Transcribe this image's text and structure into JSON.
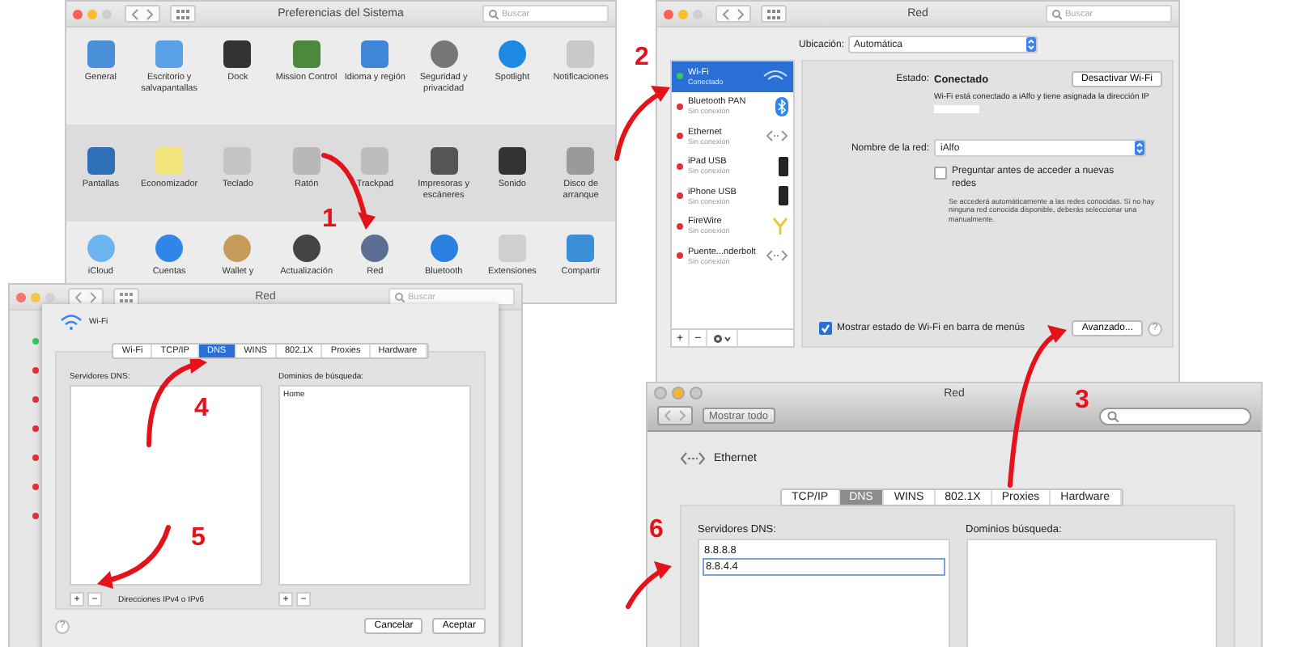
{
  "system_preferences": {
    "title": "Preferencias del Sistema",
    "search": {
      "placeholder": "Buscar"
    },
    "rows": [
      {
        "items": [
          "General",
          "Escritorio y salvapantallas",
          "Dock",
          "Mission Control",
          "Idioma y región",
          "Seguridad y privacidad",
          "Spotlight",
          "Notificaciones"
        ]
      },
      {
        "items": [
          "Pantallas",
          "Economizador",
          "Teclado",
          "Ratón",
          "Trackpad",
          "Impresoras y escáneres",
          "Sonido",
          "Disco de arranque"
        ]
      },
      {
        "items": [
          "iCloud",
          "Cuentas",
          "Wallet y",
          "Actualización",
          "Red",
          "Bluetooth",
          "Extensiones",
          "Compartir"
        ]
      }
    ]
  },
  "network_window": {
    "title": "Red",
    "search": {
      "placeholder": "Buscar"
    },
    "location_label": "Ubicación:",
    "location_value": "Automática",
    "services": [
      {
        "name": "Wi-Fi",
        "status": "Conectado",
        "selected": true,
        "color": "#34c759"
      },
      {
        "name": "Bluetooth PAN",
        "status": "Sin conexión",
        "selected": false,
        "color": "#e0303a"
      },
      {
        "name": "Ethernet",
        "status": "Sin conexión",
        "selected": false,
        "color": "#e0303a"
      },
      {
        "name": "iPad USB",
        "status": "Sin conexión",
        "selected": false,
        "color": "#e0303a"
      },
      {
        "name": "iPhone USB",
        "status": "Sin conexión",
        "selected": false,
        "color": "#e0303a"
      },
      {
        "name": "FireWire",
        "status": "Sin conexión",
        "selected": false,
        "color": "#e0303a"
      },
      {
        "name": "Puente...nderbolt",
        "status": "Sin conexión",
        "selected": false,
        "color": "#e0303a"
      }
    ],
    "sidebar_buttons": [
      "+",
      "−"
    ],
    "status_label": "Estado:",
    "status_value": "Conectado",
    "disable_button": "Desactivar Wi-Fi",
    "status_text": "Wi-Fi está conectado a iAlfo y tiene asignada la dirección IP",
    "network_name_label": "Nombre de la red:",
    "network_name_value": "iAlfo",
    "ask_checkbox": {
      "label": "Preguntar antes de acceder a nuevas redes",
      "checked": false
    },
    "ask_help": "Se accederá automáticamente a las redes conocidas. Si no hay ninguna red conocida disponible, deberás seleccionar una manualmente.",
    "menu_checkbox": {
      "label": "Mostrar estado de Wi-Fi en barra de menús",
      "checked": true
    },
    "advanced_button": "Avanzado...",
    "help_button": "?"
  },
  "advanced_sheet": {
    "window_title": "Red",
    "search": {
      "placeholder": "Buscar"
    },
    "background_dots": [
      {
        "color": "#34c759"
      },
      {
        "color": "#e0303a"
      },
      {
        "color": "#e0303a"
      },
      {
        "color": "#e0303a"
      },
      {
        "color": "#e0303a"
      },
      {
        "color": "#e0303a"
      },
      {
        "color": "#e0303a"
      }
    ],
    "service": "Wi-Fi",
    "tabs": [
      {
        "label": "Wi-Fi",
        "selected": false
      },
      {
        "label": "TCP/IP",
        "selected": false
      },
      {
        "label": "DNS",
        "selected": true
      },
      {
        "label": "WINS",
        "selected": false
      },
      {
        "label": "802.1X",
        "selected": false
      },
      {
        "label": "Proxies",
        "selected": false
      },
      {
        "label": "Hardware",
        "selected": false
      }
    ],
    "dns_label": "Servidores DNS:",
    "domains_label": "Dominios de búsqueda:",
    "domains": [
      "Home"
    ],
    "list_buttons": [
      "+",
      "−"
    ],
    "dns_hint": "Direcciones IPv4 o IPv6",
    "domain_buttons": [
      "+",
      "−"
    ],
    "help_button": "?",
    "cancel_button": "Cancelar",
    "ok_button": "Aceptar"
  },
  "ethernet_window": {
    "title": "Red",
    "show_all_button": "Mostrar todo",
    "service": "Ethernet",
    "tabs": [
      {
        "label": "TCP/IP",
        "selected": false
      },
      {
        "label": "DNS",
        "selected": true
      },
      {
        "label": "WINS",
        "selected": false
      },
      {
        "label": "802.1X",
        "selected": false
      },
      {
        "label": "Proxies",
        "selected": false
      },
      {
        "label": "Hardware",
        "selected": false
      }
    ],
    "dns_label": "Servidores DNS:",
    "dns_servers": [
      {
        "value": "8.8.8.8",
        "editing": false
      },
      {
        "value": "8.8.4.4",
        "editing": true
      }
    ],
    "domains_label": "Dominios búsqueda:"
  },
  "annotations": [
    {
      "label": "1"
    },
    {
      "label": "2"
    },
    {
      "label": "3"
    },
    {
      "label": "4"
    },
    {
      "label": "5"
    },
    {
      "label": "6"
    }
  ]
}
